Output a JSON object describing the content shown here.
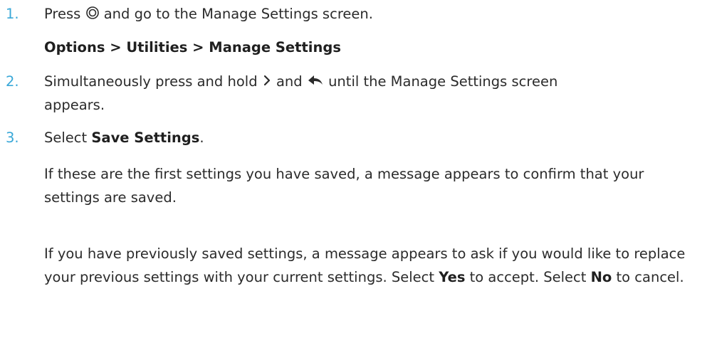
{
  "steps": [
    {
      "number": "1.",
      "text_before_icon": "Press",
      "icon": "ok-button-icon",
      "text_after_icon": "and go to the Manage Settings screen.",
      "path": "Options > Utilities > Manage Settings"
    },
    {
      "number": "2.",
      "text_part1": "Simultaneously press and hold",
      "icon1": "right-chevron-icon",
      "text_part2": "and",
      "icon2": "back-arrow-icon",
      "text_part3": "until the Manage Settings screen",
      "text_line2": "appears."
    },
    {
      "number": "3.",
      "text_before": "Select",
      "bold": "Save Settings",
      "text_after": ".",
      "para1": "If these are the first settings you have saved, a message appears to confirm that your settings are saved.",
      "para2_before_yes": "If you have previously saved settings, a message appears to ask if you would like to replace your previous settings with your current settings. Select",
      "yes": "Yes",
      "para2_between": "to accept. Select",
      "no": "No",
      "para2_end": "to cancel."
    }
  ],
  "colors": {
    "step_number": "#3aa8d8",
    "text": "#2b2b2b"
  }
}
